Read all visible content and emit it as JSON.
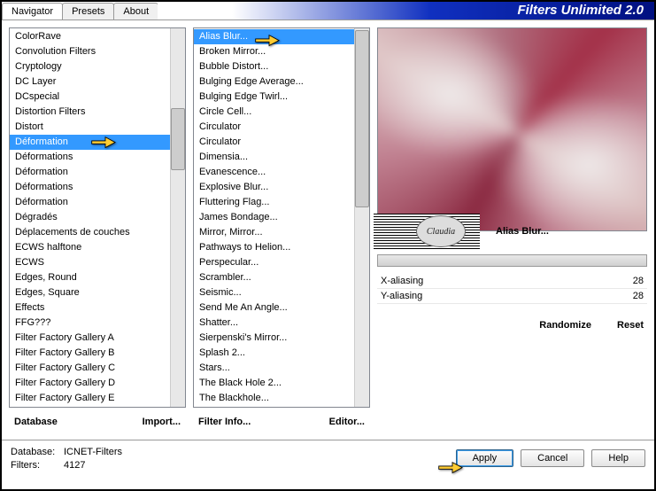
{
  "header": {
    "tabs": [
      "Navigator",
      "Presets",
      "About"
    ],
    "active_tab": 0,
    "title": "Filters Unlimited 2.0"
  },
  "categories": {
    "items": [
      "ColorRave",
      "Convolution Filters",
      "Cryptology",
      "DC Layer",
      "DCspecial",
      "Distortion Filters",
      "Distort",
      "Déformation",
      "Déformations",
      "Déformation",
      "Déformations",
      "Déformation",
      "Dégradés",
      "Déplacements de couches",
      "ECWS halftone",
      "ECWS",
      "Edges, Round",
      "Edges, Square",
      "Effects",
      "FFG???",
      "Filter Factory Gallery A",
      "Filter Factory Gallery B",
      "Filter Factory Gallery C",
      "Filter Factory Gallery D",
      "Filter Factory Gallery E"
    ],
    "selected": 7
  },
  "filters": {
    "items": [
      "Alias Blur...",
      "Broken Mirror...",
      "Bubble Distort...",
      "Bulging Edge Average...",
      "Bulging Edge Twirl...",
      "Circle Cell...",
      "Circulator",
      "Circulator",
      "Dimensia...",
      "Evanescence...",
      "Explosive Blur...",
      "Fluttering Flag...",
      "James Bondage...",
      "Mirror, Mirror...",
      "Pathways to Helion...",
      "Perspecular...",
      "Scrambler...",
      "Seismic...",
      "Send Me An Angle...",
      "Shatter...",
      "Sierpenski's Mirror...",
      "Splash 2...",
      "Stars...",
      "The Black Hole 2...",
      "The Blackhole..."
    ],
    "selected": 0
  },
  "buttons": {
    "database": "Database",
    "import": "Import...",
    "filter_info": "Filter Info...",
    "editor": "Editor...",
    "randomize": "Randomize",
    "reset": "Reset"
  },
  "selected_filter_name": "Alias Blur...",
  "params": [
    {
      "name": "X-aliasing",
      "value": 28
    },
    {
      "name": "Y-aliasing",
      "value": 28
    }
  ],
  "footer": {
    "db_label": "Database:",
    "db_value": "ICNET-Filters",
    "filters_label": "Filters:",
    "filters_value": "4127",
    "apply": "Apply",
    "cancel": "Cancel",
    "help": "Help"
  },
  "stamp_text": "Claudia"
}
